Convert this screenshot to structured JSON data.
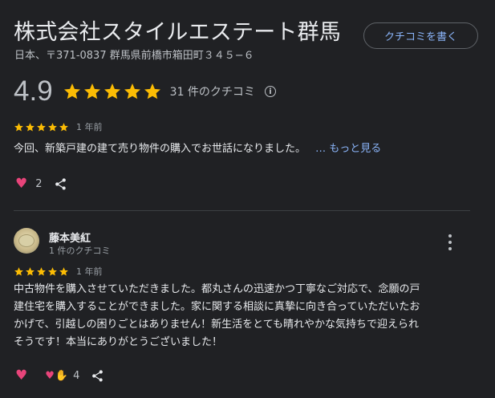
{
  "place": {
    "title": "株式会社スタイルエステート群馬",
    "address": "日本、〒371-0837 群馬県前橋市箱田町３４５−６",
    "write_review_label": "クチコミを書く"
  },
  "summary": {
    "score": "4.9",
    "stars": 5,
    "review_count_label": "31 件のクチコミ",
    "info_icon": "info-icon"
  },
  "colors": {
    "background": "#202124",
    "star": "#fbbc04",
    "link": "#8ab4f8",
    "heart": "#e8447a"
  },
  "reviews": [
    {
      "stars": 5,
      "time": "1 年前",
      "text": "今回、新築戸建の建て売り物件の購入でお世話になりました。",
      "more_label": "… もっと見る",
      "reaction_count": "2"
    },
    {
      "author": "藤本美紅",
      "author_meta": "1 件のクチコミ",
      "stars": 5,
      "time": "1 年前",
      "text_lines": [
        "中古物件を購入させていただきました。都丸さんの迅速かつ丁寧なご対応で、念願の戸",
        "建住宅を購入することができました。家に関する相談に真摯に向き合っていただいたお",
        "かげで、引越しの困りごとはありません！新生活をとても晴れやかな気持ちで迎えられ",
        "そうです！本当にありがとうございました！"
      ],
      "reaction_count": "4"
    }
  ]
}
